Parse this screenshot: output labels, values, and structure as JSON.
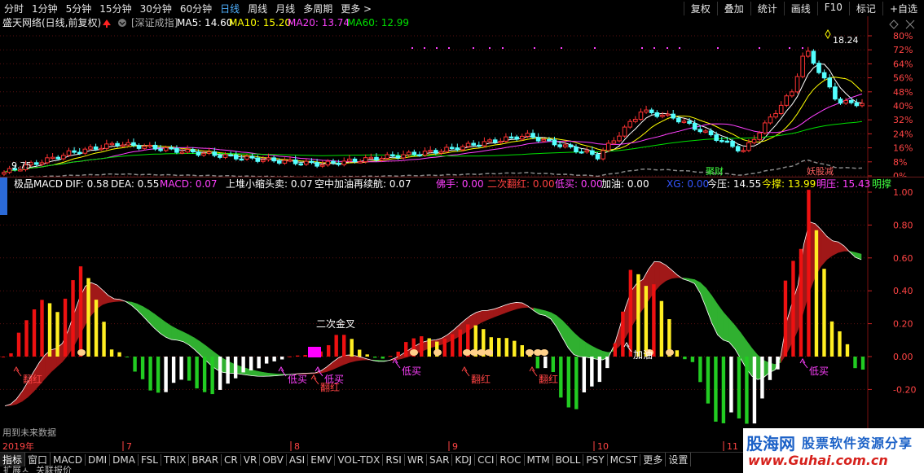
{
  "toolbar": {
    "timeframes": [
      "分时",
      "1分钟",
      "5分钟",
      "15分钟",
      "30分钟",
      "60分钟",
      "日线",
      "周线",
      "月线",
      "多周期",
      "更多 >"
    ],
    "active_timeframe": "日线",
    "right_buttons": [
      "复权",
      "叠加",
      "统计",
      "画线",
      "F10",
      "标记",
      "+自选"
    ]
  },
  "main_chart": {
    "stock_title": "盛天网络(日线,前复权)",
    "index_tag": "[深证成指]",
    "ma_labels": [
      {
        "text": "MA5: 14.60",
        "color": "#ffffff"
      },
      {
        "text": "MA10: 15.20",
        "color": "#ffff00"
      },
      {
        "text": "MA20: 13.74",
        "color": "#ff40ff"
      },
      {
        "text": "MA60: 12.99",
        "color": "#00e000"
      }
    ],
    "high_marker": "18.24",
    "low_marker": "9.75",
    "y_axis_labels": [
      "80%",
      "72%",
      "64%",
      "56%",
      "48%",
      "40%",
      "32%",
      "24%",
      "16%",
      "8%",
      "0%"
    ],
    "event_tags": [
      {
        "text": "聚财",
        "color": "#40ff40"
      },
      {
        "text": "妖股减",
        "color": "#ff6060"
      }
    ]
  },
  "indicator": {
    "name": "极品MACD",
    "values": [
      {
        "text": "DIF: 0.58",
        "color": "#ffffff"
      },
      {
        "text": "DEA: 0.55",
        "color": "#ffffff"
      },
      {
        "text": "MACD: 0.07",
        "color": "#ff40ff"
      },
      {
        "text": "上堆小缩头卖: 0.07",
        "color": "#ffffff"
      },
      {
        "text": "空中加油再续航: 0.07",
        "color": "#ffffff"
      },
      {
        "text": "佛手: 0.00",
        "color": "#ff40ff"
      },
      {
        "text": "二次翻红: 0.00",
        "color": "#ff4040"
      },
      {
        "text": "低买: 0.00",
        "color": "#ff40ff"
      },
      {
        "text": "加油: 0.00",
        "color": "#ffffff"
      },
      {
        "text": "XG: 0.00",
        "color": "#3355ff"
      },
      {
        "text": "今压: 14.55",
        "color": "#ffffff"
      },
      {
        "text": "今撑: 13.99",
        "color": "#ffff00"
      },
      {
        "text": "明压: 15.43",
        "color": "#ff40ff"
      },
      {
        "text": "明撑",
        "color": "#40ff40"
      }
    ],
    "y_axis_labels": [
      "1.00",
      "0.80",
      "0.60",
      "0.40",
      "0.20",
      "0.00",
      "-0.20"
    ],
    "annotations": {
      "golden_cross": "二次金叉",
      "fanhong": "翻红",
      "dimai": "低买",
      "jiayou": "加油"
    },
    "future_data_note": "用到未来数据"
  },
  "date_axis": [
    "2019年",
    "7",
    "8",
    "9",
    "10",
    "11"
  ],
  "tabs": [
    "指标",
    "窗口",
    "MACD",
    "DMI",
    "DMA",
    "FSL",
    "TRIX",
    "BRAR",
    "CR",
    "VR",
    "OBV",
    "ASI",
    "EMV",
    "VOL-TDX",
    "RSI",
    "WR",
    "SAR",
    "KDJ",
    "CCI",
    "ROC",
    "MTM",
    "BOLL",
    "PSY",
    "MCST",
    "更多",
    "设置"
  ],
  "active_tab": "指标",
  "bottom_line": [
    "扩展ㅅ",
    "关联报价"
  ],
  "watermark": {
    "logo": "股海网",
    "slogan": "股票软件资源分享",
    "url": "www.Guhai.com.cn"
  },
  "colors": {
    "up": "#ff3333",
    "down": "#54ffff",
    "macd_red": "#ee1111",
    "macd_yellow": "#ffee22",
    "macd_green": "#22cc22",
    "macd_white": "#ffffff",
    "band_red": "#a01818",
    "band_green": "#30b030"
  }
}
